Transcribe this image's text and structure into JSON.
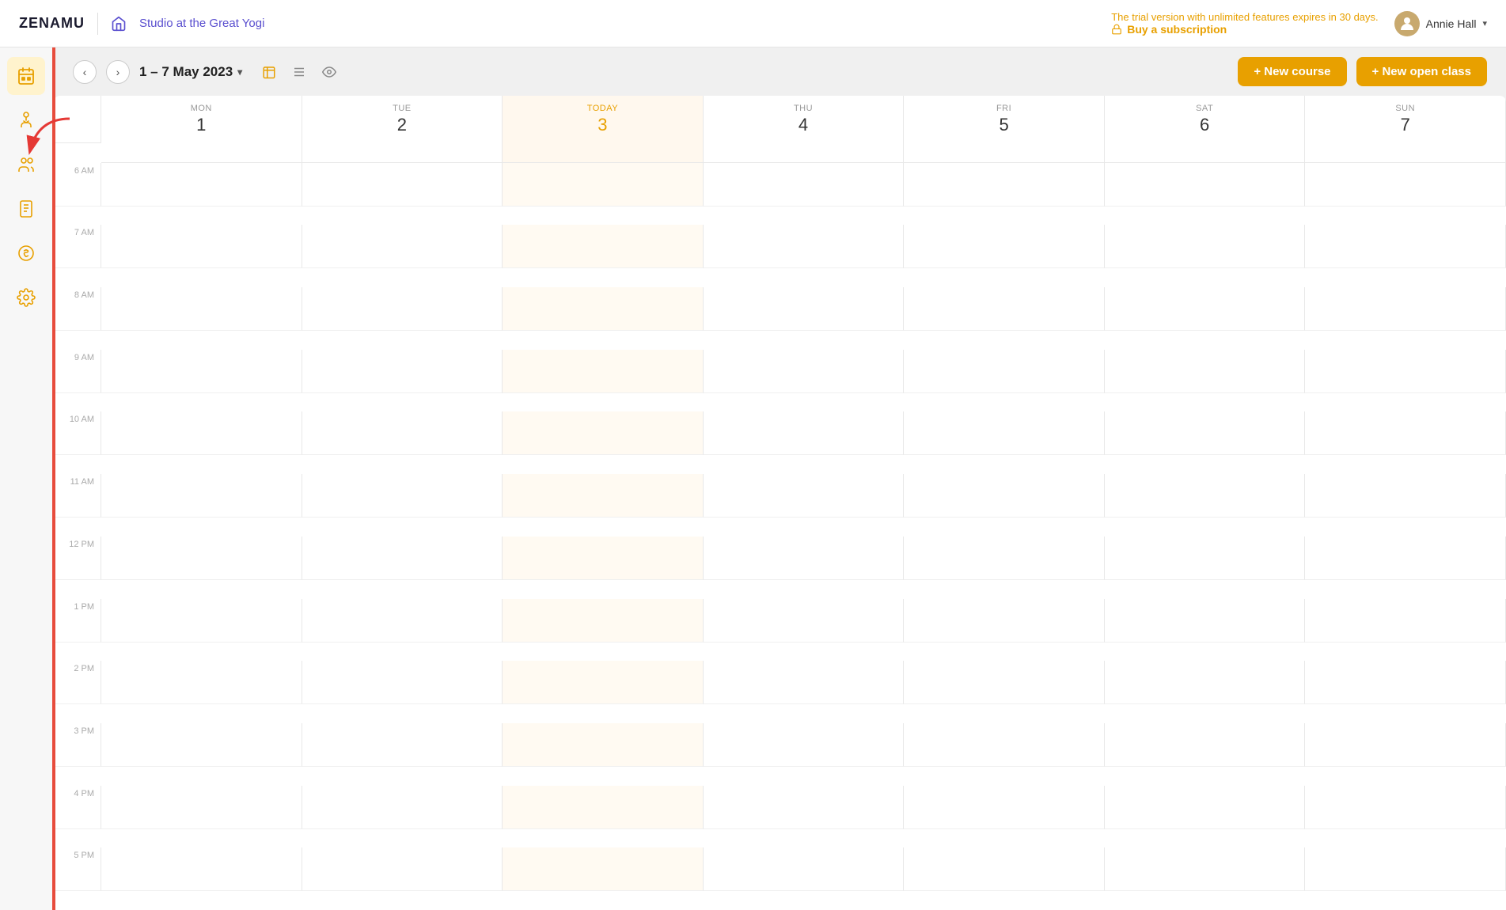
{
  "topbar": {
    "logo": "ZENAMU",
    "studio_name": "Studio at the Great Yogi",
    "trial_text": "The trial version with unlimited features expires in 30 days.",
    "buy_subscription_label": "Buy a subscription",
    "user_name": "Annie Hall"
  },
  "toolbar": {
    "date_range": "1 – 7 May 2023",
    "new_course_label": "+ New course",
    "new_open_class_label": "+ New open class"
  },
  "calendar": {
    "days": [
      {
        "name": "MON",
        "num": "1",
        "today": false
      },
      {
        "name": "TUE",
        "num": "2",
        "today": false
      },
      {
        "name": "TODAY",
        "num": "3",
        "today": true
      },
      {
        "name": "THU",
        "num": "4",
        "today": false
      },
      {
        "name": "FRI",
        "num": "5",
        "today": false
      },
      {
        "name": "SAT",
        "num": "6",
        "today": false
      },
      {
        "name": "SUN",
        "num": "7",
        "today": false
      }
    ],
    "time_slots": [
      "6 AM",
      "7 AM",
      "8 AM",
      "9 AM",
      "10 AM",
      "11 AM",
      "12 PM",
      "1 PM",
      "2 PM",
      "3 PM",
      "4 PM",
      "5 PM"
    ]
  },
  "sidebar": {
    "items": [
      {
        "id": "calendar",
        "icon": "📅",
        "label": "Calendar"
      },
      {
        "id": "classes",
        "icon": "🧘",
        "label": "Classes"
      },
      {
        "id": "clients",
        "icon": "👥",
        "label": "Clients"
      },
      {
        "id": "reports",
        "icon": "📋",
        "label": "Reports"
      },
      {
        "id": "billing",
        "icon": "💰",
        "label": "Billing"
      },
      {
        "id": "settings",
        "icon": "⚙️",
        "label": "Settings"
      }
    ]
  }
}
